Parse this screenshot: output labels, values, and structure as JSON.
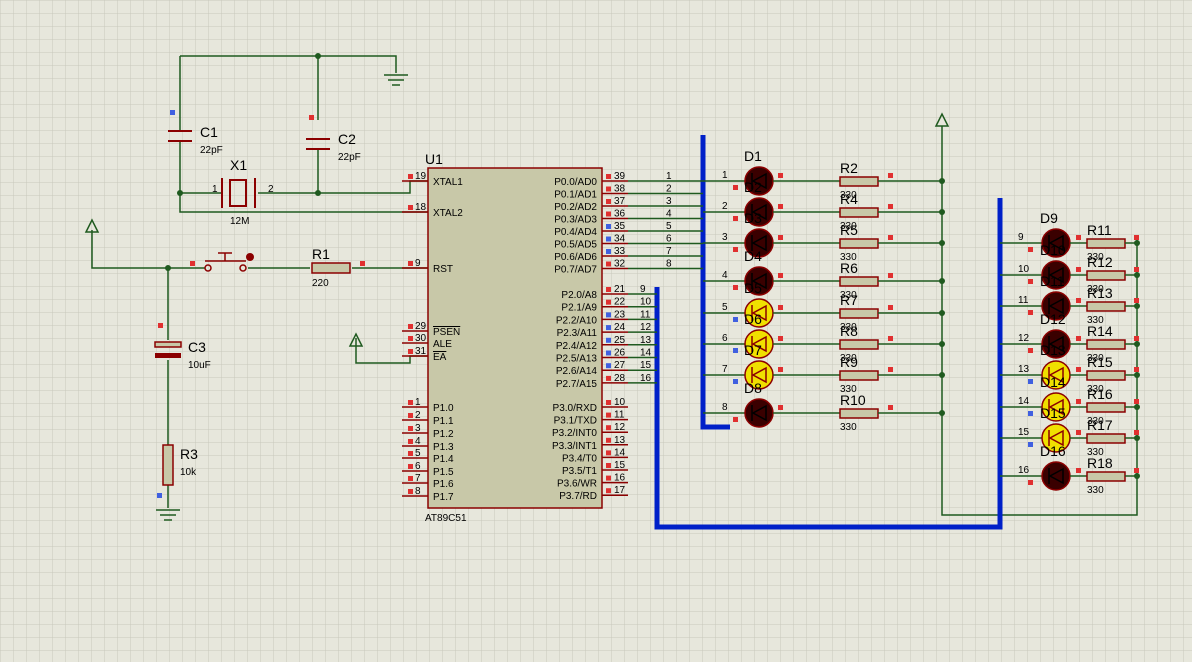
{
  "colors": {
    "wire": "#1f5a1f",
    "bus": "#0020c8",
    "component": "#8b0000",
    "body": "#c8c8a8",
    "text": "#000000",
    "led_off": "#3a0000",
    "led_on": "#f0e000",
    "pin_red": "#e03030",
    "pin_blue": "#4060e0",
    "grid": "#c9c9bc"
  },
  "mcu": {
    "ref": "U1",
    "part": "AT89C51",
    "left_pins": [
      {
        "num": "19",
        "name": "XTAL1"
      },
      {
        "num": "18",
        "name": "XTAL2"
      },
      {
        "num": "9",
        "name": "RST"
      },
      {
        "num": "29",
        "name": "PSEN"
      },
      {
        "num": "30",
        "name": "ALE"
      },
      {
        "num": "31",
        "name": "EA"
      },
      {
        "num": "1",
        "name": "P1.0"
      },
      {
        "num": "2",
        "name": "P1.1"
      },
      {
        "num": "3",
        "name": "P1.2"
      },
      {
        "num": "4",
        "name": "P1.3"
      },
      {
        "num": "5",
        "name": "P1.4"
      },
      {
        "num": "6",
        "name": "P1.5"
      },
      {
        "num": "7",
        "name": "P1.6"
      },
      {
        "num": "8",
        "name": "P1.7"
      }
    ],
    "right_pins": [
      {
        "num": "39",
        "name": "P0.0/AD0"
      },
      {
        "num": "38",
        "name": "P0.1/AD1"
      },
      {
        "num": "37",
        "name": "P0.2/AD2"
      },
      {
        "num": "36",
        "name": "P0.3/AD3"
      },
      {
        "num": "35",
        "name": "P0.4/AD4"
      },
      {
        "num": "34",
        "name": "P0.5/AD5"
      },
      {
        "num": "33",
        "name": "P0.6/AD6"
      },
      {
        "num": "32",
        "name": "P0.7/AD7"
      },
      {
        "num": "21",
        "name": "P2.0/A8"
      },
      {
        "num": "22",
        "name": "P2.1/A9"
      },
      {
        "num": "23",
        "name": "P2.2/A10"
      },
      {
        "num": "24",
        "name": "P2.3/A11"
      },
      {
        "num": "25",
        "name": "P2.4/A12"
      },
      {
        "num": "26",
        "name": "P2.5/A13"
      },
      {
        "num": "27",
        "name": "P2.6/A14"
      },
      {
        "num": "28",
        "name": "P2.7/A15"
      },
      {
        "num": "10",
        "name": "P3.0/RXD"
      },
      {
        "num": "11",
        "name": "P3.1/TXD"
      },
      {
        "num": "12",
        "name": "P3.2/INT0"
      },
      {
        "num": "13",
        "name": "P3.3/INT1"
      },
      {
        "num": "14",
        "name": "P3.4/T0"
      },
      {
        "num": "15",
        "name": "P3.5/T1"
      },
      {
        "num": "16",
        "name": "P3.6/WR"
      },
      {
        "num": "17",
        "name": "P3.7/RD"
      }
    ],
    "p0_net_labels": [
      "1",
      "2",
      "3",
      "4",
      "5",
      "6",
      "7",
      "8"
    ],
    "p2_net_labels": [
      "9",
      "10",
      "11",
      "12",
      "13",
      "14",
      "15",
      "16"
    ]
  },
  "components": {
    "c1": {
      "ref": "C1",
      "value": "22pF"
    },
    "c2": {
      "ref": "C2",
      "value": "22pF"
    },
    "x1": {
      "ref": "X1",
      "value": "12M",
      "pin1": "1",
      "pin2": "2"
    },
    "r1": {
      "ref": "R1",
      "value": "220"
    },
    "c3": {
      "ref": "C3",
      "value": "10uF"
    },
    "r3": {
      "ref": "R3",
      "value": "10k"
    }
  },
  "led_group_1": {
    "leds": [
      {
        "ref": "D1",
        "net": "1",
        "on": false,
        "res_ref": "R2",
        "res_value": "330"
      },
      {
        "ref": "D2",
        "net": "2",
        "on": false,
        "res_ref": "R4",
        "res_value": "330"
      },
      {
        "ref": "D3",
        "net": "3",
        "on": false,
        "res_ref": "R5",
        "res_value": "330"
      },
      {
        "ref": "D4",
        "net": "4",
        "on": false,
        "res_ref": "R6",
        "res_value": "330"
      },
      {
        "ref": "D5",
        "net": "5",
        "on": true,
        "res_ref": "R7",
        "res_value": "330"
      },
      {
        "ref": "D6",
        "net": "6",
        "on": true,
        "res_ref": "R8",
        "res_value": "330"
      },
      {
        "ref": "D7",
        "net": "7",
        "on": true,
        "res_ref": "R9",
        "res_value": "330"
      },
      {
        "ref": "D8",
        "net": "8",
        "on": false,
        "res_ref": "R10",
        "res_value": "330"
      }
    ]
  },
  "led_group_2": {
    "leds": [
      {
        "ref": "D9",
        "net": "9",
        "on": false,
        "res_ref": "R11",
        "res_value": "330"
      },
      {
        "ref": "D10",
        "net": "10",
        "on": false,
        "res_ref": "R12",
        "res_value": "330"
      },
      {
        "ref": "D11",
        "net": "11",
        "on": false,
        "res_ref": "R13",
        "res_value": "330"
      },
      {
        "ref": "D12",
        "net": "12",
        "on": false,
        "res_ref": "R14",
        "res_value": "330"
      },
      {
        "ref": "D13",
        "net": "13",
        "on": true,
        "res_ref": "R15",
        "res_value": "330"
      },
      {
        "ref": "D14",
        "net": "14",
        "on": true,
        "res_ref": "R16",
        "res_value": "330"
      },
      {
        "ref": "D15",
        "net": "15",
        "on": true,
        "res_ref": "R17",
        "res_value": "330"
      },
      {
        "ref": "D16",
        "net": "16",
        "on": false,
        "res_ref": "R18",
        "res_value": "330"
      }
    ]
  }
}
